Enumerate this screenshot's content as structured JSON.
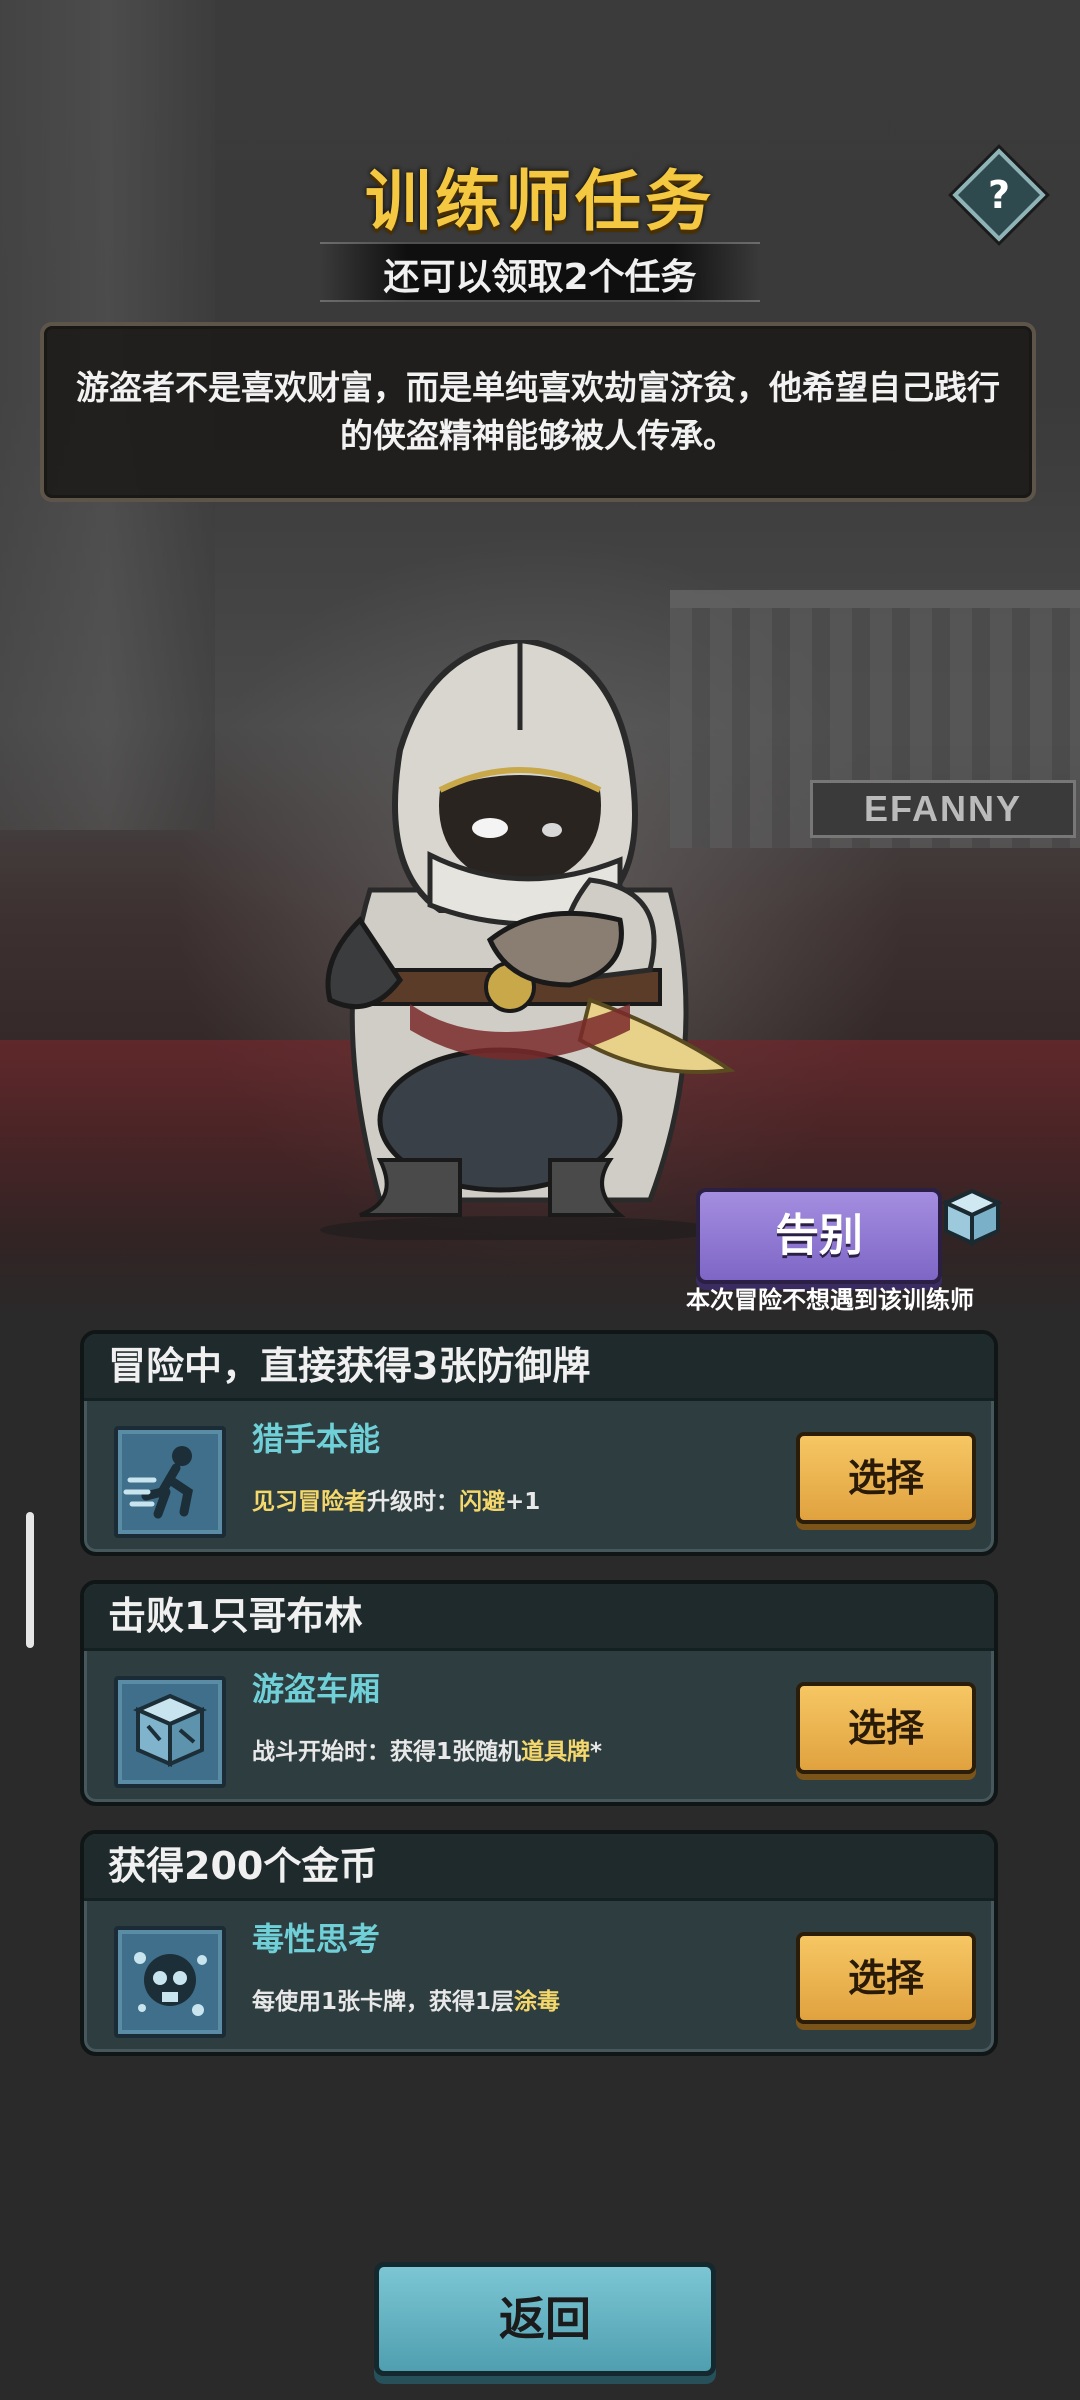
{
  "header": {
    "title": "训练师任务",
    "subtitle": "还可以领取2个任务",
    "help_label": "?"
  },
  "description": {
    "line1": "游盗者不是喜欢财富，而是单纯喜欢劫富济贫，他希望自己践行",
    "line2": "的侠盗精神能够被人传承。"
  },
  "scene": {
    "sign_text": "EFANNY"
  },
  "farewell": {
    "label": "告别",
    "note": "本次冒险不想遇到该训练师"
  },
  "tasks": [
    {
      "title": "冒险中，直接获得3张防御牌",
      "skill_name": "猎手本能",
      "desc_parts": [
        "见习冒险者",
        "升级时：",
        "闪避",
        "+1"
      ],
      "icon": "running-figure-icon",
      "button": "选择"
    },
    {
      "title": "击败1只哥布林",
      "skill_name": "游盗车厢",
      "desc_parts": [
        "战斗开始时：获得1张随机",
        "道具牌",
        "*"
      ],
      "icon": "crate-icon",
      "button": "选择"
    },
    {
      "title": "获得200个金币",
      "skill_name": "毒性思考",
      "desc_parts": [
        "每使用1张卡牌，获得1层",
        "涂毒"
      ],
      "icon": "poison-skull-icon",
      "button": "选择"
    }
  ],
  "footer": {
    "back_label": "返回"
  },
  "colors": {
    "title": "#f5c842",
    "skill_name": "#6fd0d8",
    "highlight": "#f5d86b",
    "select_button": "#f0b450",
    "farewell_button": "#9a84d8",
    "back_button": "#6ab8c8"
  }
}
